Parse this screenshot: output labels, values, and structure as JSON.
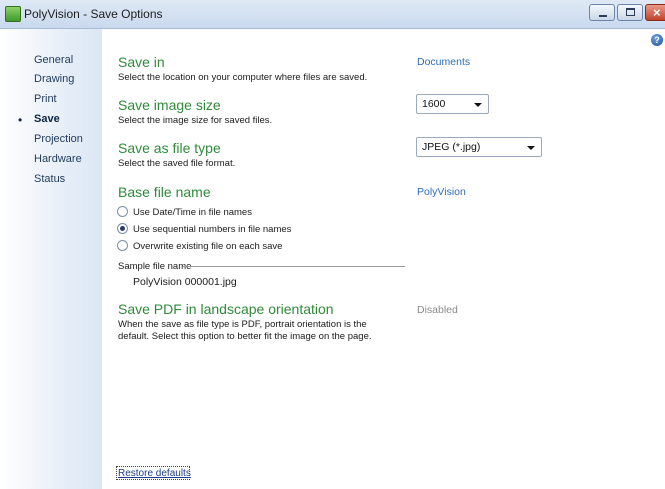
{
  "window": {
    "title": "PolyVision - Save Options"
  },
  "nav": {
    "items": [
      "General",
      "Drawing",
      "Print",
      "Save",
      "Projection",
      "Hardware",
      "Status"
    ],
    "active": "Save",
    "active_marker": "•"
  },
  "help": {
    "glyph": "?"
  },
  "sections": {
    "save_in": {
      "heading": "Save in",
      "description": "Select the location on your computer where files are saved.",
      "value": "Documents"
    },
    "image_size": {
      "heading": "Save image size",
      "description": "Select the image size for saved files.",
      "value": "1600"
    },
    "file_type": {
      "heading": "Save as file type",
      "description": "Select the saved file format.",
      "value": "JPEG (*.jpg)"
    },
    "base_name": {
      "heading": "Base file name",
      "value": "PolyVision",
      "options": [
        {
          "label": "Use Date/Time in file names",
          "checked": false
        },
        {
          "label": "Use sequential numbers in file names",
          "checked": true
        },
        {
          "label": "Overwrite existing file on each save",
          "checked": false
        }
      ],
      "sample_label": "Sample file name",
      "sample_value": "PolyVision 000001.jpg"
    },
    "pdf": {
      "heading": "Save PDF in landscape orientation",
      "description_line1": "When the save as file type is PDF, portrait orientation is the",
      "description_line2": "default. Select this option to better fit the image on the page.",
      "value": "Disabled"
    }
  },
  "footer": {
    "restore_label": "Restore defaults"
  },
  "colors": {
    "heading": "#2f8b3a",
    "link": "#2f6db5",
    "disabled": "#8a8a8a"
  }
}
